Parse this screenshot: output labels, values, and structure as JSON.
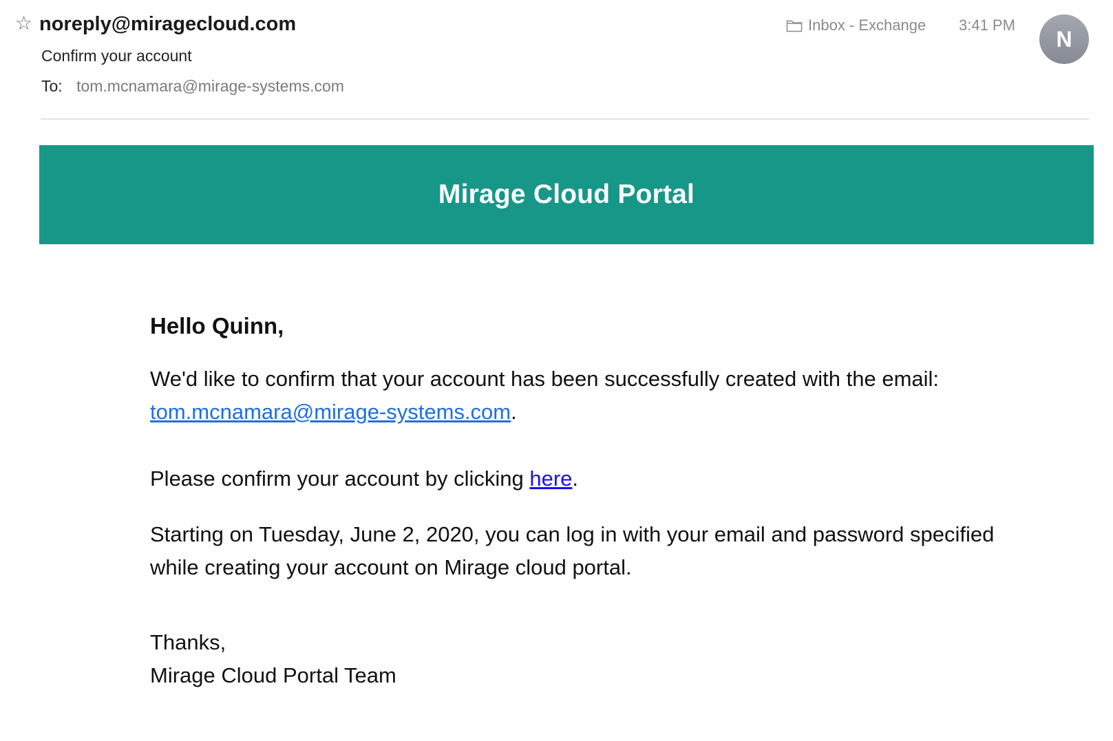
{
  "header": {
    "sender": "noreply@miragecloud.com",
    "subject": "Confirm your account",
    "to_label": "To:",
    "to_address": "tom.mcnamara@mirage-systems.com",
    "mailbox": "Inbox - Exchange",
    "time": "3:41 PM",
    "avatar_initial": "N"
  },
  "icons": {
    "star": "star-icon",
    "folder": "folder-icon"
  },
  "colors": {
    "banner": "#179788",
    "link": "#1f6fe0",
    "here_link": "#1a0dff",
    "avatar": "#959aa3"
  },
  "banner": {
    "title": "Mirage Cloud Portal"
  },
  "body": {
    "greeting": "Hello Quinn,",
    "para1_prefix": "We'd like to confirm that your account has been successfully created with the email: ",
    "para1_email": "tom.mcnamara@mirage-systems.com",
    "para1_suffix": ".",
    "para2_prefix": "Please confirm your account by clicking ",
    "para2_link": "here",
    "para2_suffix": ".",
    "para3": "Starting on Tuesday, June 2, 2020, you can log in with your email and password specified while creating your account on Mirage cloud portal.",
    "signoff": "Thanks,",
    "signature": "Mirage Cloud Portal Team"
  }
}
